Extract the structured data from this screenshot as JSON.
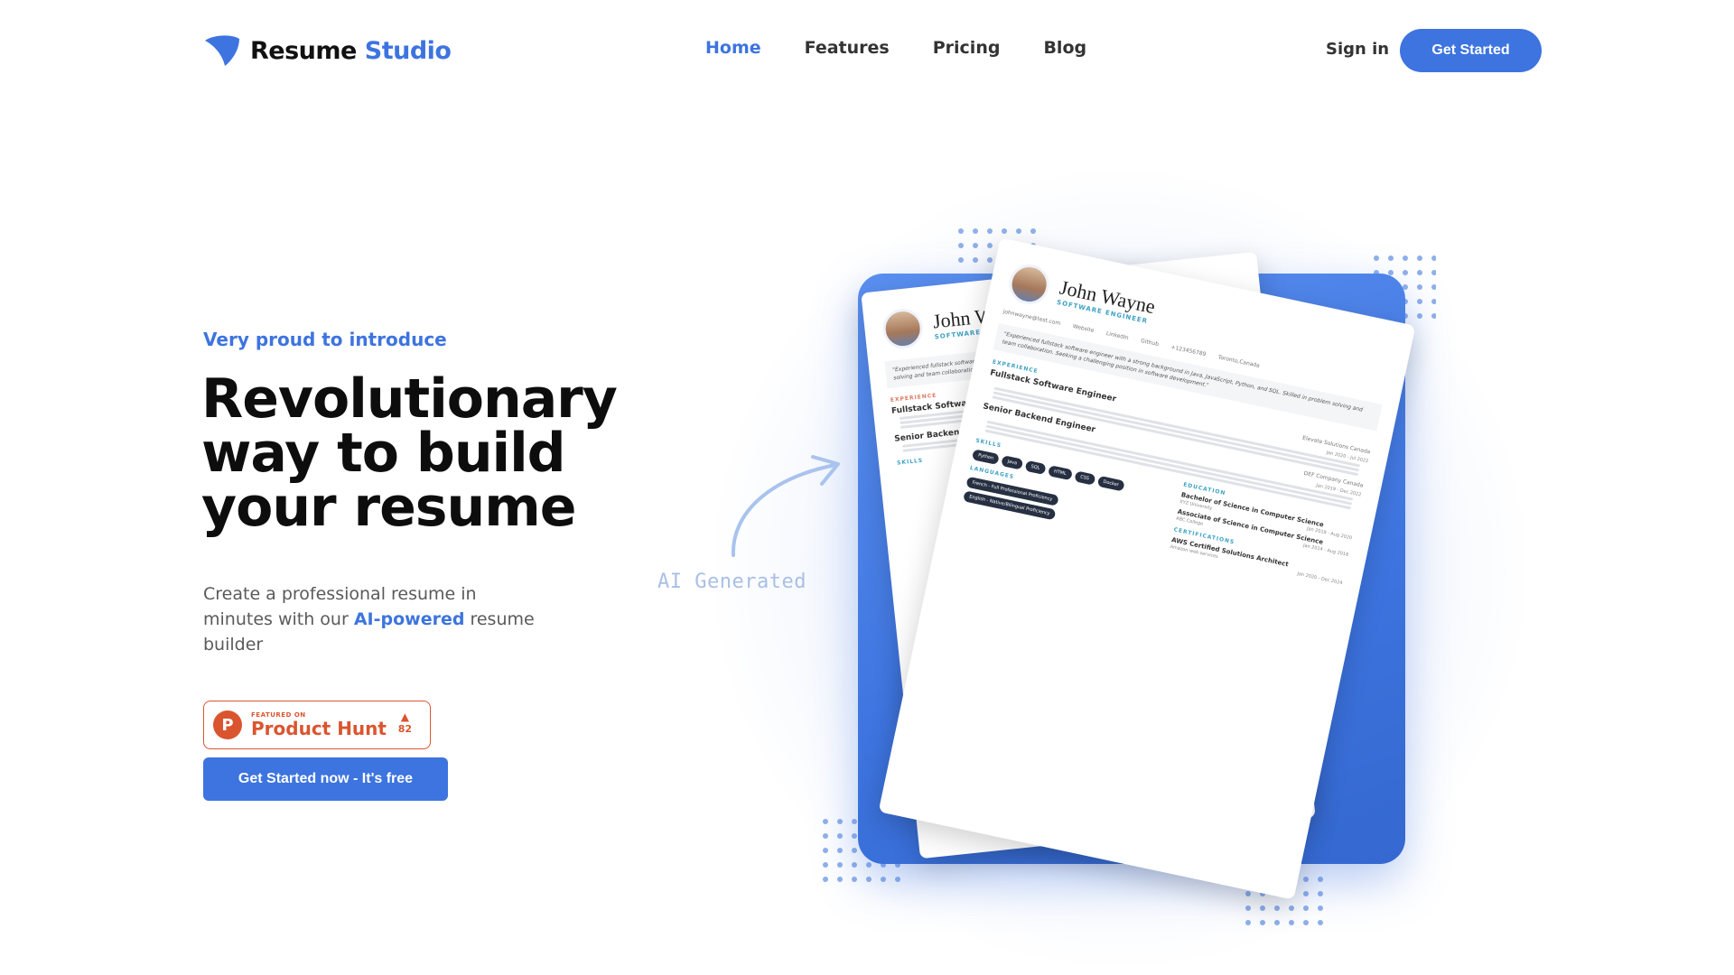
{
  "brand": {
    "name_part1": "Resume",
    "name_part2": "Studio",
    "accent_color": "#3d74df"
  },
  "nav": {
    "links": [
      "Home",
      "Features",
      "Pricing",
      "Blog"
    ],
    "active": "Home",
    "signin_label": "Sign in",
    "cta_label": "Get Started"
  },
  "hero": {
    "eyebrow": "Very proud to introduce",
    "headline_lines": [
      "Revolutionary",
      "way to build",
      "your resume"
    ],
    "sub_before": "Create a professional resume in minutes with our ",
    "sub_highlight": "AI-powered",
    "sub_after": " resume builder",
    "cta_label": "Get Started now - It's free"
  },
  "product_hunt": {
    "small_label": "FEATURED ON",
    "big_label": "Product Hunt",
    "votes": "82",
    "color": "#da552f"
  },
  "illustration": {
    "ai_label": "AI Generated",
    "resume_back": {
      "name": "John Wayne",
      "role": "SOFTWARE ENGINEER"
    },
    "resume_front": {
      "name": "John Wayne",
      "role": "SOFTWARE ENGINEER",
      "contacts": [
        "johnwayne@test.com",
        "Website",
        "LinkedIn",
        "Github",
        "+123456789",
        "Toronto,Canada"
      ],
      "summary": "\"Experienced fullstack software engineer with a strong background in Java, JavaScript, Python, and SQL. Skilled in problem solving and team collaboration. Seeking a challenging position in software development.\"",
      "experience_label": "EXPERIENCE",
      "jobs": [
        {
          "title": "Fullstack Software Engineer",
          "company": "Elevate Solutions Canada",
          "dates": "Jan 2020 - Jul 2022"
        },
        {
          "title": "Senior Backend Engineer",
          "company": "DEF Company Canada",
          "dates": "Jan 2019 - Dec 2022"
        }
      ],
      "skills_label": "SKILLS",
      "skills": [
        "Python",
        "Java",
        "SQL",
        "HTML",
        "CSS",
        "Docker"
      ],
      "languages_label": "LANGUAGES",
      "languages": [
        "French - Full Professional Proficiency",
        "English - Native/Bilingual Proficiency"
      ],
      "education_label": "EDUCATION",
      "education": [
        {
          "degree": "Bachelor of Science in Computer Science",
          "school": "XYZ University",
          "dates": "Jan 2019 - Aug 2020"
        },
        {
          "degree": "Associate of Science in Computer Science",
          "school": "ABC College",
          "dates": "Jan 2014 - Aug 2018"
        }
      ],
      "certifications_label": "CERTIFICATIONS",
      "certifications": [
        {
          "name": "AWS Certified Solutions Architect",
          "issuer": "Amazon web services",
          "dates": "Jan 2020 - Dec 2024"
        }
      ]
    }
  }
}
